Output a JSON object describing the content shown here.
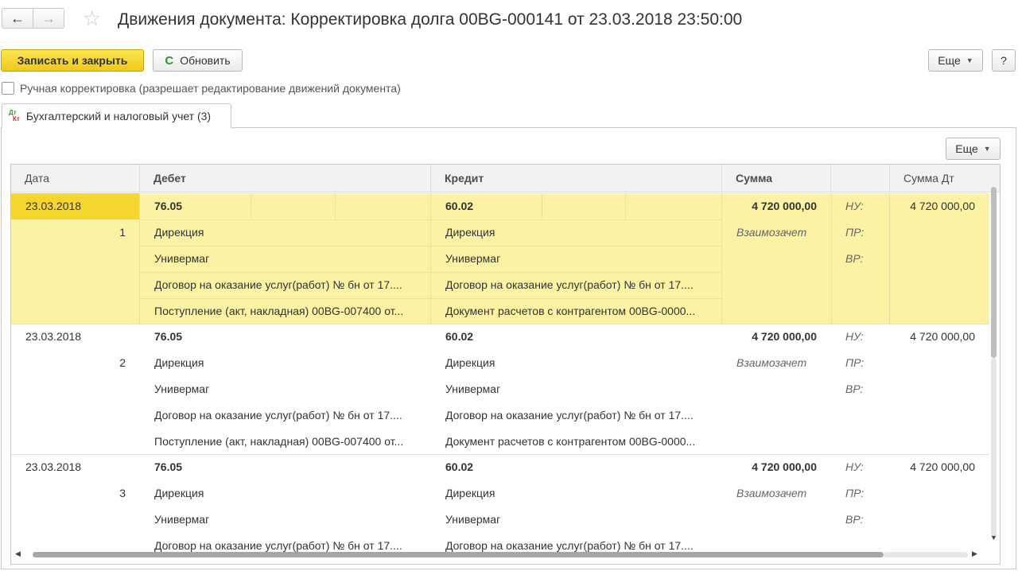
{
  "header": {
    "back_icon": "←",
    "forward_icon": "→",
    "star_icon": "☆",
    "title": "Движения документа: Корректировка долга 00BG-000141 от 23.03.2018 23:50:00"
  },
  "toolbar": {
    "save_close": "Записать и закрыть",
    "refresh_icon": "C",
    "refresh": "Обновить",
    "more": "Еще",
    "help": "?"
  },
  "manual_edit": {
    "label": "Ручная корректировка (разрешает редактирование движений документа)"
  },
  "tab": {
    "icon_dt": "Дт",
    "icon_kt": "Кт",
    "label": "Бухгалтерский и налоговый учет (3)"
  },
  "panel": {
    "more": "Еще"
  },
  "table": {
    "columns": [
      "Дата",
      "Дебет",
      "Кредит",
      "Сумма",
      "",
      "Сумма Дт"
    ],
    "rows": [
      {
        "date": "23.03.2018",
        "num": "1",
        "debit": [
          "76.05",
          "Дирекция",
          "Универмаг",
          "Договор на оказание услуг(работ) № бн от 17....",
          "Поступление (акт, накладная) 00BG-007400 от..."
        ],
        "credit": [
          "60.02",
          "Дирекция",
          "Универмаг",
          "Договор на оказание услуг(работ) № бн от 17....",
          "Документ расчетов с контрагентом 00BG-0000..."
        ],
        "sum": "4 720 000,00",
        "sum_note": "Взаимозачет",
        "types": [
          "НУ:",
          "ПР:",
          "ВР:"
        ],
        "sum_dt": "4 720 000,00"
      },
      {
        "date": "23.03.2018",
        "num": "2",
        "debit": [
          "76.05",
          "Дирекция",
          "Универмаг",
          "Договор на оказание услуг(работ) № бн от 17....",
          "Поступление (акт, накладная) 00BG-007400 от..."
        ],
        "credit": [
          "60.02",
          "Дирекция",
          "Универмаг",
          "Договор на оказание услуг(работ) № бн от 17....",
          "Документ расчетов с контрагентом 00BG-0000..."
        ],
        "sum": "4 720 000,00",
        "sum_note": "Взаимозачет",
        "types": [
          "НУ:",
          "ПР:",
          "ВР:"
        ],
        "sum_dt": "4 720 000,00"
      },
      {
        "date": "23.03.2018",
        "num": "3",
        "debit": [
          "76.05",
          "Дирекция",
          "Универмаг",
          "Договор на оказание услуг(работ) № бн от 17....",
          ""
        ],
        "credit": [
          "60.02",
          "Дирекция",
          "Универмаг",
          "Договор на оказание услуг(работ) № бн от 17....",
          ""
        ],
        "sum": "4 720 000,00",
        "sum_note": "Взаимозачет",
        "types": [
          "НУ:",
          "ПР:",
          "ВР:"
        ],
        "sum_dt": "4 720 000,00"
      }
    ]
  },
  "colors": {
    "selected_row": "#fbf2a3",
    "selected_date": "#f4d62e",
    "primary_button": "#f0c81a"
  }
}
